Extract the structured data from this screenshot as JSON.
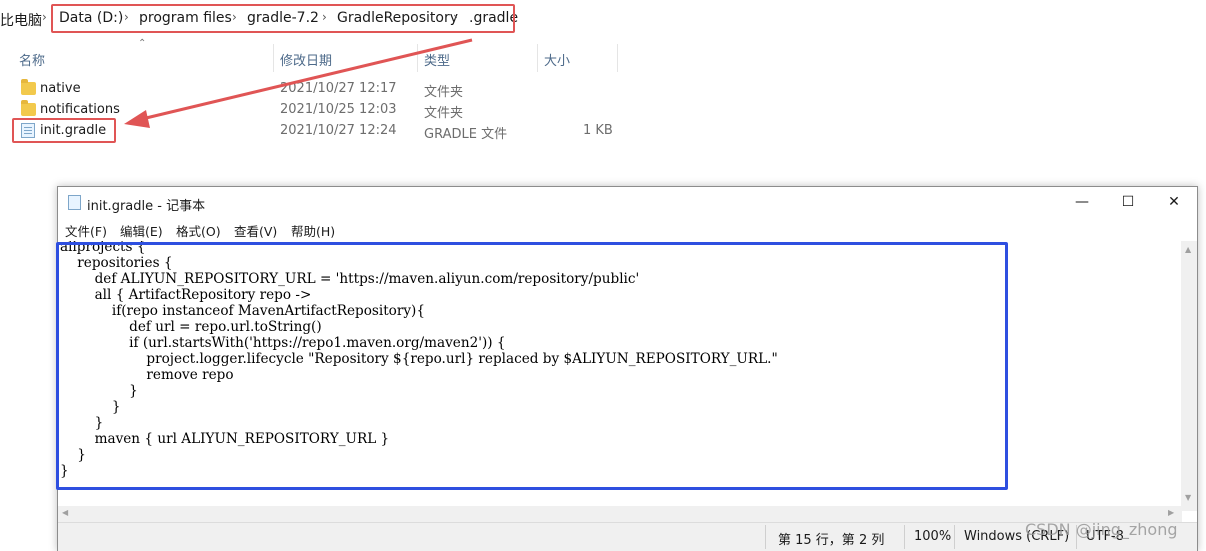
{
  "explorer": {
    "breadcrumb": {
      "root_partial": "比电脑",
      "items": [
        "Data (D:)",
        "program files",
        "gradle-7.2",
        "GradleRepository",
        ".gradle"
      ]
    },
    "columns": {
      "name": "名称",
      "date": "修改日期",
      "type": "类型",
      "size": "大小"
    },
    "files": [
      {
        "name": "native",
        "date": "2021/10/27 12:17",
        "type": "文件夹",
        "size": "",
        "icon": "folder-icon"
      },
      {
        "name": "notifications",
        "date": "2021/10/25 12:03",
        "type": "文件夹",
        "size": "",
        "icon": "folder-icon"
      },
      {
        "name": "init.gradle",
        "date": "2021/10/27 12:24",
        "type": "GRADLE 文件",
        "size": "1 KB",
        "icon": "document-icon"
      }
    ],
    "annotation_color": "#e05555"
  },
  "notepad": {
    "title": "init.gradle - 记事本",
    "menu": [
      "文件(F)",
      "编辑(E)",
      "格式(O)",
      "查看(V)",
      "帮助(H)"
    ],
    "content": "allprojects {\n    repositories {\n        def ALIYUN_REPOSITORY_URL = 'https://maven.aliyun.com/repository/public'\n        all { ArtifactRepository repo ->\n            if(repo instanceof MavenArtifactRepository){\n                def url = repo.url.toString()\n                if (url.startsWith('https://repo1.maven.org/maven2')) {\n                    project.logger.lifecycle \"Repository ${repo.url} replaced by $ALIYUN_REPOSITORY_URL.\"\n                    remove repo\n                }\n            }\n        }\n        maven { url ALIYUN_REPOSITORY_URL }\n    }\n}",
    "status": {
      "position": "第 15 行，第 2 列",
      "zoom": "100%",
      "line_ending": "Windows (CRLF)",
      "encoding": "UTF-8"
    },
    "annotation_color": "#2e4fe0"
  },
  "watermark": "CSDN @jing_zhong"
}
